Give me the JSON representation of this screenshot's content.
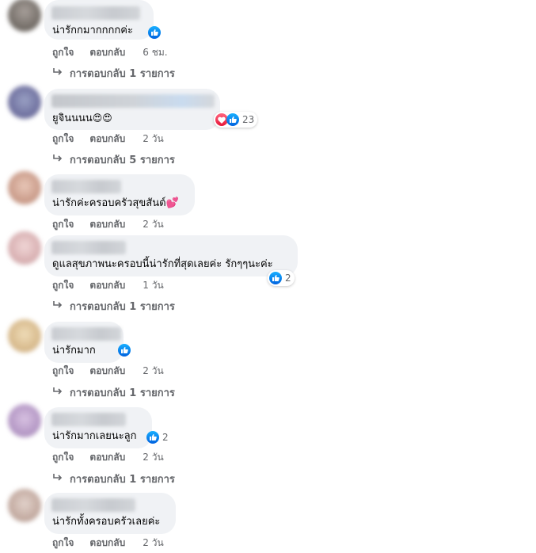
{
  "colors": {
    "like_blue": "#0866ff",
    "love_red": "#f33e58",
    "bubble": "#f0f2f5",
    "meta": "#65676b"
  },
  "actions": {
    "like": "ถูกใจ",
    "reply": "ตอบกลับ"
  },
  "comments": [
    {
      "text": "น่ารักกมากกกกค่ะ",
      "reaction_icons": [
        "like-icon"
      ],
      "reaction_count": "",
      "time": "6 ชม.",
      "replies": "การตอบกลับ 1 รายการ"
    },
    {
      "text": "ยูจินนนน",
      "emoji": "😍😍",
      "reaction_icons": [
        "love-icon",
        "like-icon"
      ],
      "reaction_count": "23",
      "time": "2 วัน",
      "replies": "การตอบกลับ 5 รายการ"
    },
    {
      "text": "น่ารักค่ะครอบครัวสุขสันต์",
      "emoji": "💕",
      "reaction_icons": [],
      "reaction_count": "",
      "time": "2 วัน",
      "replies": ""
    },
    {
      "text": "ดูแลสุขภาพนะครอบนี้น่ารักที่สุดเลยค่ะ รักๆๆนะค่ะ",
      "reaction_icons": [
        "like-icon"
      ],
      "reaction_count": "2",
      "time": "1 วัน",
      "replies": "การตอบกลับ 1 รายการ"
    },
    {
      "text": "น่ารักมาก",
      "reaction_icons": [
        "like-icon"
      ],
      "reaction_count": "",
      "time": "2 วัน",
      "replies": "การตอบกลับ 1 รายการ"
    },
    {
      "text": "น่ารักมากเลยนะลูก",
      "reaction_icons": [
        "like-icon"
      ],
      "reaction_count": "2",
      "time": "2 วัน",
      "replies": "การตอบกลับ 1 รายการ"
    },
    {
      "text": "น่ารักทั้งครอบครัวเลยค่ะ",
      "reaction_icons": [],
      "reaction_count": "",
      "time": "2 วัน",
      "replies": ""
    }
  ]
}
